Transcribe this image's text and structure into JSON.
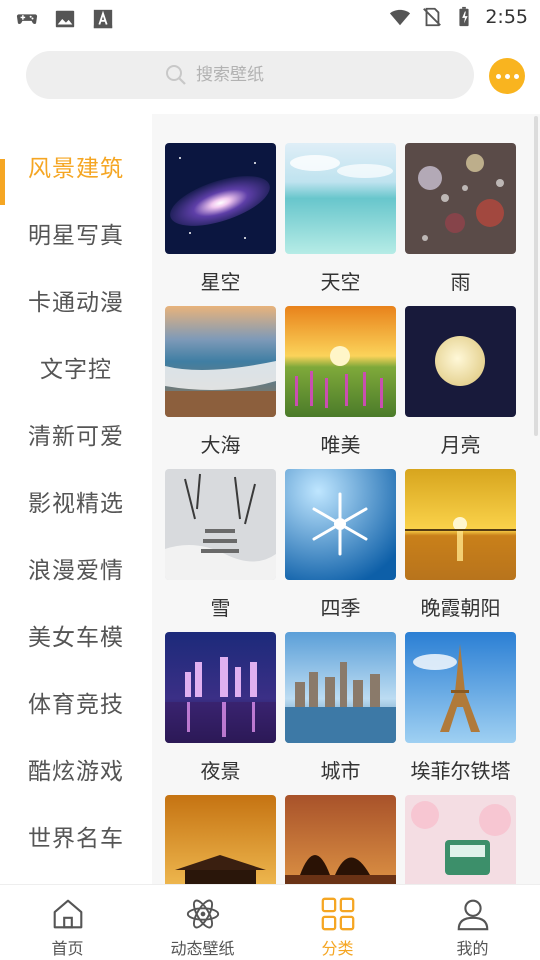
{
  "status_bar": {
    "time": "2:55",
    "left_icons": [
      "gamepad-icon",
      "image-icon",
      "font-icon"
    ],
    "right_icons": [
      "wifi-icon",
      "no-sim-icon",
      "battery-icon"
    ]
  },
  "search": {
    "placeholder": "搜索壁纸",
    "more_icon": "more-dots-icon"
  },
  "sidebar": {
    "items": [
      {
        "label": "风景建筑",
        "active": true
      },
      {
        "label": "明星写真"
      },
      {
        "label": "卡通动漫"
      },
      {
        "label": "文字控"
      },
      {
        "label": "清新可爱"
      },
      {
        "label": "影视精选"
      },
      {
        "label": "浪漫爱情"
      },
      {
        "label": "美女车模"
      },
      {
        "label": "体育竞技"
      },
      {
        "label": "酷炫游戏"
      },
      {
        "label": "世界名车"
      }
    ]
  },
  "grid": {
    "tiles": [
      {
        "label": "星空",
        "image": "galaxy"
      },
      {
        "label": "天空",
        "image": "sky-water"
      },
      {
        "label": "雨",
        "image": "raindrops"
      },
      {
        "label": "大海",
        "image": "sea-shore"
      },
      {
        "label": "唯美",
        "image": "sunset-flowers"
      },
      {
        "label": "月亮",
        "image": "full-moon"
      },
      {
        "label": "雪",
        "image": "snow-stairs"
      },
      {
        "label": "四季",
        "image": "snowflake"
      },
      {
        "label": "晚霞朝阳",
        "image": "sunset-sea"
      },
      {
        "label": "夜景",
        "image": "night-city"
      },
      {
        "label": "城市",
        "image": "city-skyline"
      },
      {
        "label": "埃菲尔铁塔",
        "image": "eiffel-tower"
      },
      {
        "label": "",
        "image": "palace-sunset"
      },
      {
        "label": "",
        "image": "tree-sunset"
      },
      {
        "label": "",
        "image": "cherry-tram"
      }
    ]
  },
  "bottom_nav": {
    "items": [
      {
        "label": "首页",
        "icon": "home-icon"
      },
      {
        "label": "动态壁纸",
        "icon": "atom-icon"
      },
      {
        "label": "分类",
        "icon": "grid-icon",
        "active": true
      },
      {
        "label": "我的",
        "icon": "user-icon"
      }
    ]
  },
  "colors": {
    "accent": "#f5a623",
    "more_button": "#f9b41f",
    "search_bg": "#eeeeee",
    "content_bg": "#f7f7f7"
  }
}
